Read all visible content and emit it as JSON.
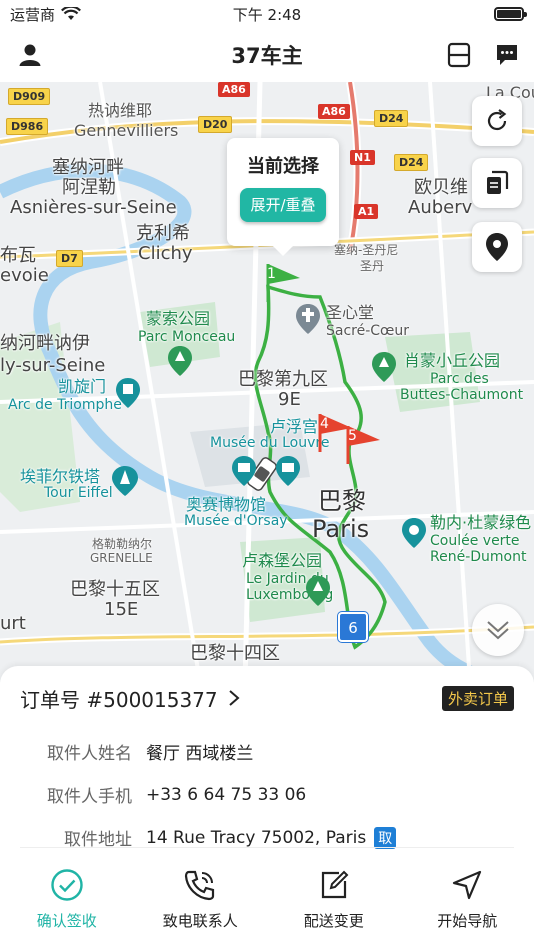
{
  "status_bar": {
    "carrier": "运营商",
    "time": "下午 2:48"
  },
  "nav": {
    "title": "37车主"
  },
  "map": {
    "popup_title": "当前选择",
    "popup_button": "展开/重叠",
    "road_badges": [
      "D909",
      "D986",
      "D20",
      "A86",
      "D24",
      "N1",
      "D24",
      "A1",
      "D7",
      "A86"
    ],
    "labels": {
      "gennevilliers_cn": "热讷维耶",
      "gennevilliers": "Gennevilliers",
      "asnieres_cn": "塞纳河畔",
      "asnieres_cn2": "阿涅勒",
      "asnieres": "Asnières-sur-Seine",
      "clichy_cn": "克利希",
      "clichy": "Clichy",
      "levallois_cn": "布瓦",
      "levallois": "evoie",
      "saintdenis_cn": "塞纳-圣丹尼",
      "saintdenis_short": "圣丹",
      "aubervilliers_cn": "欧贝维",
      "aubervilliers": "Auberv",
      "courneuve": "La Cour",
      "neuilly_cn": "纳河畔讷伊",
      "neuilly": "ly-sur-Seine",
      "monceau_cn": "蒙索公园",
      "monceau": "Parc Monceau",
      "sacre_cn": "圣心堂",
      "sacre": "Sacré-Cœur",
      "buttes_cn": "肖蒙小丘公园",
      "buttes1": "Parc des",
      "buttes2": "Buttes-Chaumont",
      "arc_cn": "凯旋门",
      "arc": "Arc de Triomphe",
      "ninth_cn": "巴黎第九区",
      "ninth": "9E",
      "louvre_cn": "卢浮宫",
      "louvre": "Musée du Louvre",
      "eiffel_cn": "埃菲尔铁塔",
      "eiffel": "Tour Eiffel",
      "orsay_cn": "奥赛博物馆",
      "orsay": "Musée d'Orsay",
      "paris_cn": "巴黎",
      "paris": "Paris",
      "grenelle_cn": "格勒勒纳尔",
      "grenelle": "GRENELLE",
      "coulee_cn": "勒内·杜蒙绿色",
      "coulee1": "Coulée verte",
      "coulee2": "René-Dumont",
      "lux_cn": "卢森堡公园",
      "lux1": "Le Jardin du",
      "lux2": "Luxembourg",
      "fifteenth_cn": "巴黎十五区",
      "fifteenth": "15E",
      "court": "urt",
      "fourteenth_cn": "巴黎十四区"
    },
    "markers": [
      "1",
      "4",
      "5",
      "6"
    ],
    "colors": {
      "route": "#3cb043",
      "start_flag": "#3cb043",
      "stop_flag": "#e5432f",
      "end_marker": "#2a78d6"
    }
  },
  "order": {
    "number": "订单号 #500015377",
    "tag": "外卖订单",
    "rows": [
      {
        "label": "取件人姓名",
        "value": "餐厅 西域楼兰"
      },
      {
        "label": "取件人手机",
        "value": "+33 6 64 75 33 06"
      },
      {
        "label": "取件地址",
        "value": "14 Rue Tracy 75002, Paris",
        "badge": "取"
      }
    ]
  },
  "tabs": [
    {
      "label": "确认签收",
      "icon": "check-circle-icon",
      "active": true
    },
    {
      "label": "致电联系人",
      "icon": "phone-icon",
      "active": false
    },
    {
      "label": "配送变更",
      "icon": "edit-icon",
      "active": false
    },
    {
      "label": "开始导航",
      "icon": "navigation-icon",
      "active": false
    }
  ],
  "theme": {
    "accent": "#20b4a6",
    "takeout_tag_bg": "#222222",
    "takeout_tag_text": "#f3c74a"
  }
}
